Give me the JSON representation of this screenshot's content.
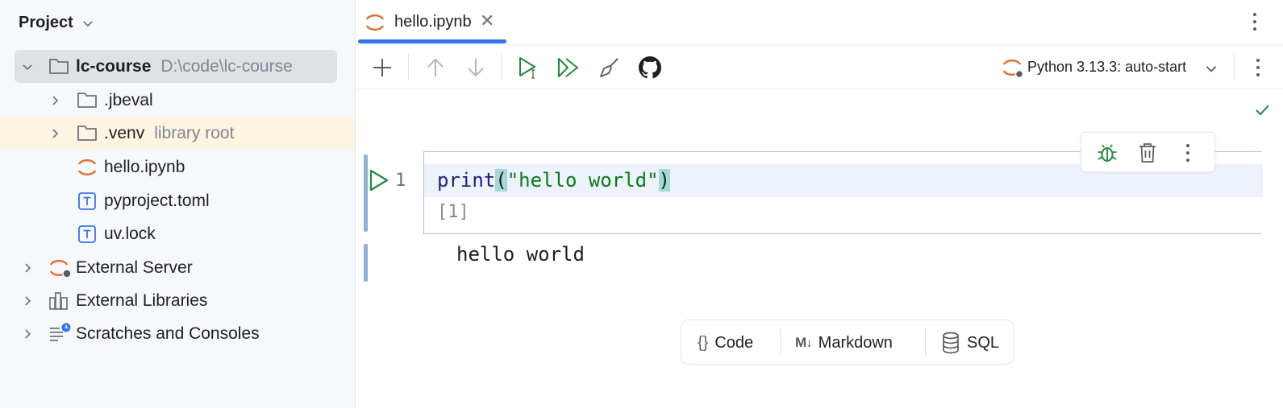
{
  "project_panel": {
    "title": "Project",
    "tree": {
      "root": {
        "name": "lc-course",
        "path": "D:\\code\\lc-course"
      },
      "items": [
        {
          "name": ".jbeval",
          "hint": ""
        },
        {
          "name": ".venv",
          "hint": "library root"
        },
        {
          "name": "hello.ipynb",
          "hint": ""
        },
        {
          "name": "pyproject.toml",
          "hint": ""
        },
        {
          "name": "uv.lock",
          "hint": ""
        }
      ],
      "top_level": [
        {
          "name": "External Server"
        },
        {
          "name": "External Libraries"
        },
        {
          "name": "Scratches and Consoles"
        }
      ]
    }
  },
  "editor": {
    "tab": {
      "label": "hello.ipynb",
      "close": "✕"
    },
    "kernel": {
      "label": "Python 3.13.3: auto-start"
    },
    "cell": {
      "line_number": "1",
      "code": {
        "fn": "print",
        "open": "(",
        "str": "\"hello world\"",
        "close": ")"
      },
      "exec_count": "[1]",
      "output": "hello world"
    },
    "add_cell": {
      "code": {
        "glyph": "{}",
        "label": "Code"
      },
      "markdown": {
        "glyph": "M↓",
        "label": "Markdown"
      },
      "sql": {
        "label": "SQL"
      }
    }
  },
  "colors": {
    "accent": "#3574f0",
    "run_green": "#208a3c",
    "jupyter_orange": "#e46e2e",
    "selected_row": "#dfe1e5",
    "library_highlight": "#fdf5e1"
  }
}
